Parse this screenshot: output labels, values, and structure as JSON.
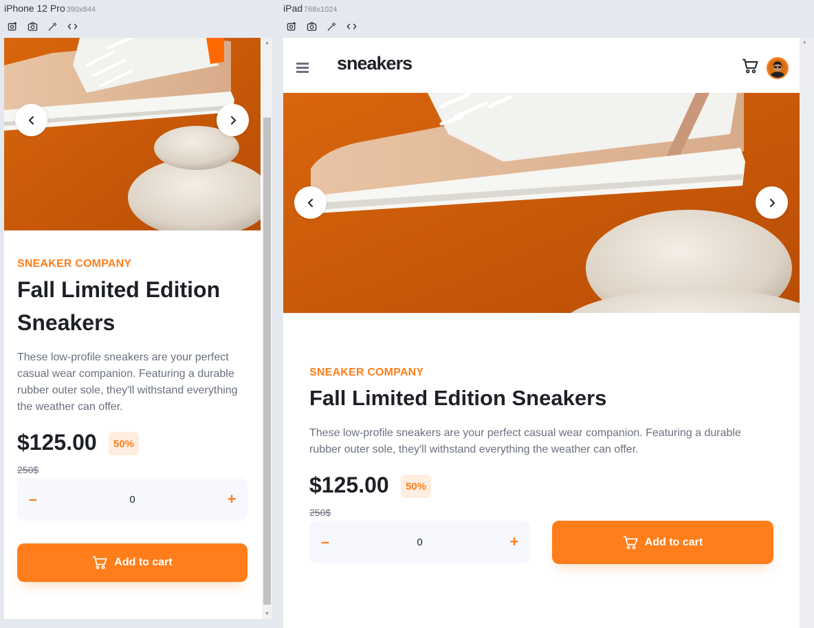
{
  "devices": {
    "phone": {
      "name": "iPhone 12 Pro",
      "size": "390x844"
    },
    "tablet": {
      "name": "iPad",
      "size": "768x1024"
    }
  },
  "toolbar_icons": [
    "rotate-screenshot-icon",
    "camera-icon",
    "pipette-icon",
    "code-icon"
  ],
  "product": {
    "brand": "SNEAKER COMPANY",
    "title": "Fall Limited Edition Sneakers",
    "description": "These low-profile sneakers are your perfect casual wear companion. Featuring a durable rubber outer sole, they'll withstand everything the weather can offer.",
    "price": "$125.00",
    "discount": "50%",
    "old_price": "250$",
    "quantity": "0",
    "minus_label": "–",
    "plus_label": "+",
    "add_to_cart": "Add to cart"
  },
  "navbar": {
    "logo": "sneakers"
  },
  "colors": {
    "accent": "#ff7e1b",
    "accent_pale": "#ffede0",
    "dark": "#1d2026",
    "grey": "#69707d",
    "hero_bg": "#d35d06"
  }
}
